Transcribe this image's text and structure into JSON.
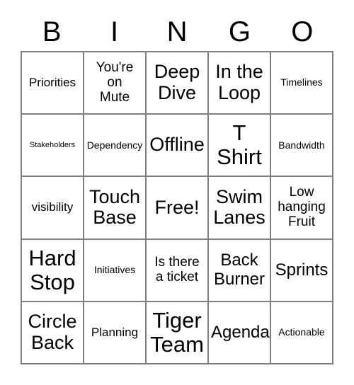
{
  "card": {
    "title": "Bingo Card",
    "header_letters": [
      "B",
      "I",
      "N",
      "G",
      "O"
    ],
    "colors": {
      "background": "#ffffff",
      "text": "#000000",
      "grid_line": "#808080"
    },
    "grid_size": "5x5",
    "rows": [
      [
        {
          "text": "Priorities",
          "size": "md"
        },
        {
          "text": "You're\non\nMute",
          "size": "lg"
        },
        {
          "text": "Deep\nDive",
          "size": "xxl"
        },
        {
          "text": "In the\nLoop",
          "size": "xxl"
        },
        {
          "text": "Timelines",
          "size": "sm"
        }
      ],
      [
        {
          "text": "Stakeholders",
          "size": "xs"
        },
        {
          "text": "Dependency",
          "size": "sm"
        },
        {
          "text": "Offline",
          "size": "xxl"
        },
        {
          "text": "T\nShirt",
          "size": "huge"
        },
        {
          "text": "Bandwidth",
          "size": "sm"
        }
      ],
      [
        {
          "text": "visibility",
          "size": "md"
        },
        {
          "text": "Touch\nBase",
          "size": "xxl"
        },
        {
          "text": "Free!",
          "size": "xxl"
        },
        {
          "text": "Swim\nLanes",
          "size": "xxl"
        },
        {
          "text": "Low\nhanging\nFruit",
          "size": "lg"
        }
      ],
      [
        {
          "text": "Hard\nStop",
          "size": "huge"
        },
        {
          "text": "Initiatives",
          "size": "sm"
        },
        {
          "text": "Is there\na ticket",
          "size": "lg"
        },
        {
          "text": "Back\nBurner",
          "size": "xl"
        },
        {
          "text": "Sprints",
          "size": "xl"
        }
      ],
      [
        {
          "text": "Circle\nBack",
          "size": "xxl"
        },
        {
          "text": "Planning",
          "size": "md"
        },
        {
          "text": "Tiger\nTeam",
          "size": "huge"
        },
        {
          "text": "Agenda",
          "size": "xl"
        },
        {
          "text": "Actionable",
          "size": "sm"
        }
      ]
    ]
  }
}
